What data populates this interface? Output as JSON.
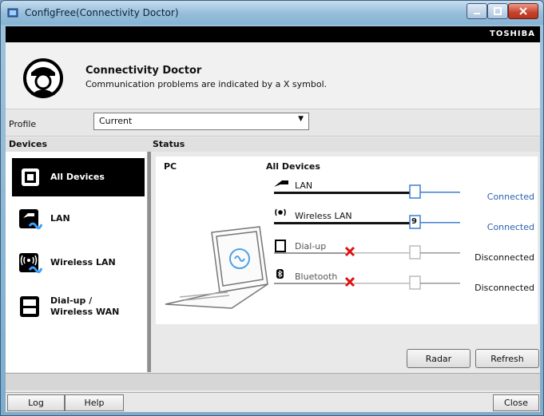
{
  "window": {
    "title": "ConfigFree(Connectivity Doctor)",
    "brand": "TOSHIBA"
  },
  "header": {
    "title": "Connectivity Doctor",
    "subtitle": "Communication problems are indicated by a X symbol."
  },
  "profile": {
    "label": "Profile",
    "value": "Current"
  },
  "columns": {
    "devices": "Devices",
    "status": "Status"
  },
  "devices": [
    {
      "label": "All Devices",
      "icon": "chip-icon",
      "selected": true
    },
    {
      "label": "LAN",
      "icon": "lan-icon"
    },
    {
      "label": "Wireless LAN",
      "icon": "wireless-lan-icon"
    },
    {
      "label": "Dial-up / Wireless WAN",
      "line1": "Dial-up /",
      "line2": "Wireless WAN",
      "icon": "modem-icon"
    }
  ],
  "status": {
    "pc_label": "PC",
    "all_label": "All Devices",
    "rows": [
      {
        "name": "LAN",
        "state": "Connected",
        "ok": true
      },
      {
        "name": "Wireless LAN",
        "state": "Connected",
        "ok": true,
        "channel": "9"
      },
      {
        "name": "Dial-up",
        "state": "Disconnected",
        "ok": false
      },
      {
        "name": "Bluetooth",
        "state": "Disconnected",
        "ok": false
      }
    ]
  },
  "buttons": {
    "radar": "Radar",
    "refresh": "Refresh",
    "log": "Log",
    "help": "Help",
    "close": "Close"
  },
  "colors": {
    "connected": "#2b5fb0",
    "error": "#e01010",
    "line": "#3b7fcf"
  }
}
